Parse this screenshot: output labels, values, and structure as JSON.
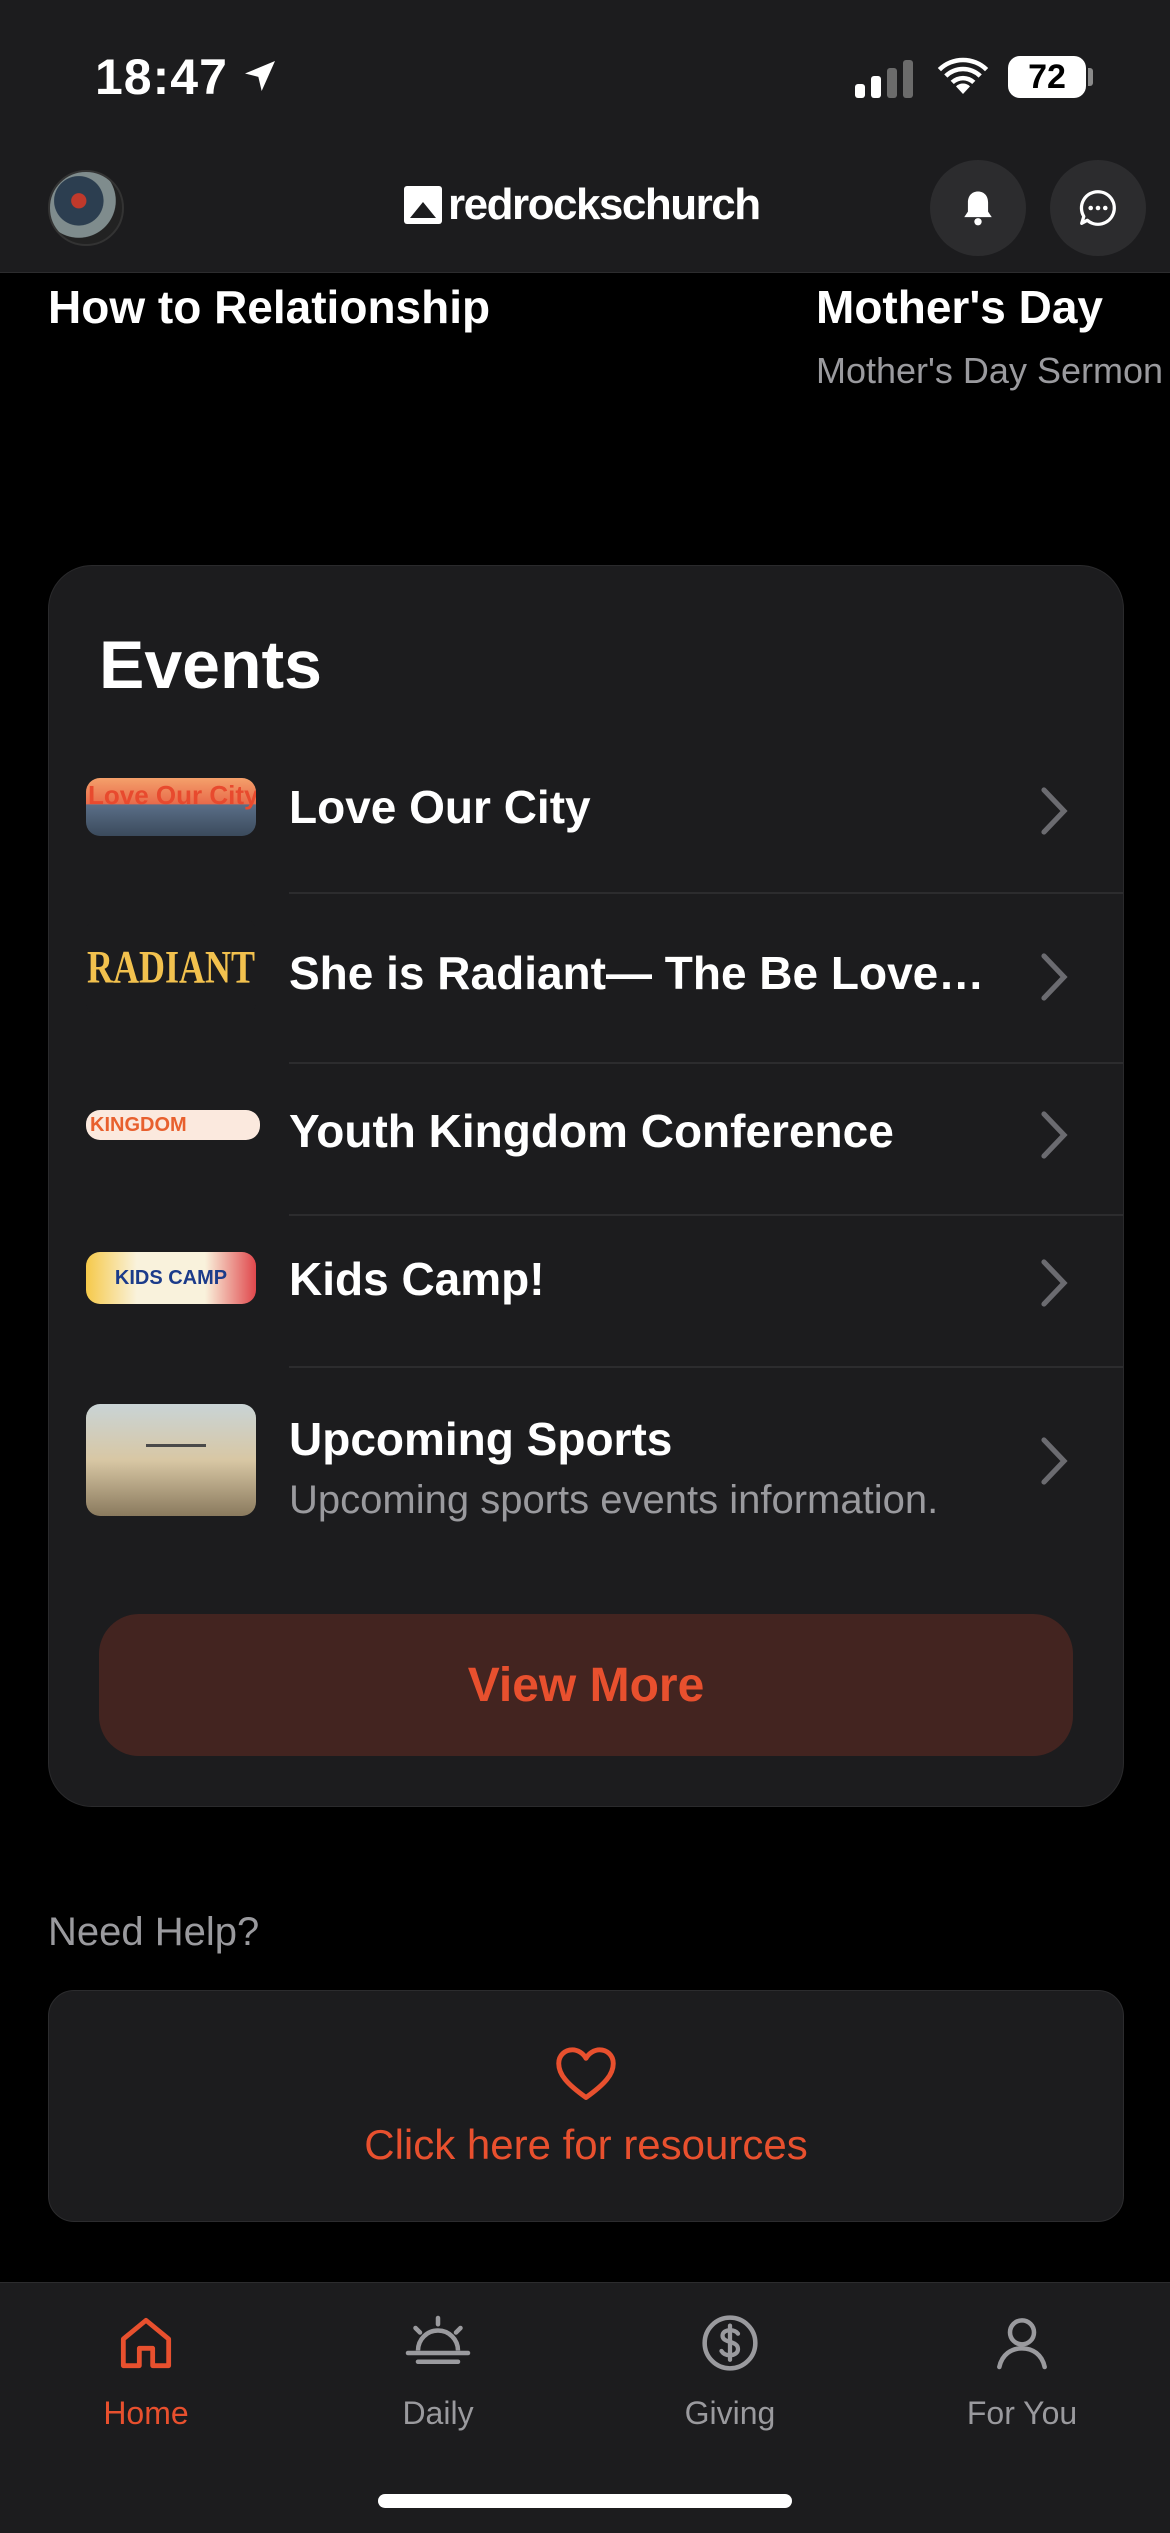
{
  "status_bar": {
    "time": "18:47",
    "battery": "72"
  },
  "header": {
    "logo_text": "redrockschurch"
  },
  "sermons": [
    {
      "title": "How to Relationship",
      "subtitle": ""
    },
    {
      "title": "Mother's Day",
      "subtitle": "Mother's Day Sermon"
    }
  ],
  "events": {
    "title": "Events",
    "items": [
      {
        "label": "Love Our City",
        "subtitle": "",
        "thumb_text": "Love Our City"
      },
      {
        "label": "She is Radiant— The Be Love…",
        "subtitle": "",
        "thumb_text": "RADIANT"
      },
      {
        "label": "Youth Kingdom Conference",
        "subtitle": "",
        "thumb_text": "KINGDOM"
      },
      {
        "label": "Kids Camp!",
        "subtitle": "",
        "thumb_text": "KIDS CAMP"
      },
      {
        "label": "Upcoming Sports",
        "subtitle": "Upcoming sports events information.",
        "thumb_text": ""
      }
    ],
    "view_more_label": "View More"
  },
  "help": {
    "heading": "Need Help?",
    "link_text": "Click here for resources"
  },
  "tabs": [
    {
      "label": "Home",
      "icon": "home-icon",
      "active": true
    },
    {
      "label": "Daily",
      "icon": "sunrise-icon",
      "active": false
    },
    {
      "label": "Giving",
      "icon": "dollar-icon",
      "active": false
    },
    {
      "label": "For You",
      "icon": "person-icon",
      "active": false
    }
  ],
  "colors": {
    "accent": "#e8502e",
    "surface": "#1c1c1e",
    "background": "#000000",
    "button_bg": "#432420"
  }
}
